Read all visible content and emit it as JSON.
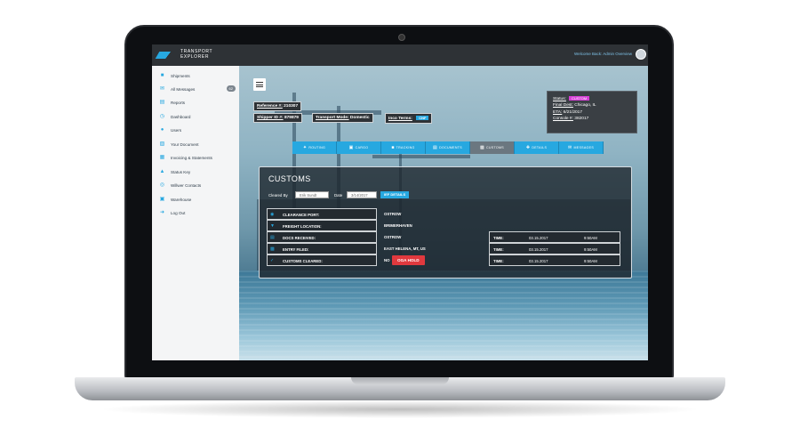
{
  "header": {
    "logo_line1": "TRANSPORT",
    "logo_line2": "EXPLORER",
    "welcome": "Welcome Back: Admin Overview"
  },
  "sidebar": {
    "items": [
      {
        "label": "Shipments",
        "icon": "truck-icon"
      },
      {
        "label": "All Messages",
        "icon": "messages-icon",
        "badge": "62"
      },
      {
        "label": "Reports",
        "icon": "reports-icon"
      },
      {
        "label": "Dashboard",
        "icon": "dashboard-icon"
      },
      {
        "label": "Users",
        "icon": "user-icon"
      },
      {
        "label": "Your Document",
        "icon": "document-icon"
      },
      {
        "label": "Invoicing & Statements",
        "icon": "invoice-icon"
      },
      {
        "label": "Status Key",
        "icon": "key-icon"
      },
      {
        "label": "Willwer Contacts",
        "icon": "contacts-icon"
      },
      {
        "label": "Warehouse",
        "icon": "warehouse-icon"
      },
      {
        "label": "Log Out",
        "icon": "logout-icon"
      }
    ]
  },
  "shipment": {
    "reference_label": "Reference #:",
    "reference_value": "210307",
    "shipper_label": "Shipper ID #:",
    "shipper_value": "879879",
    "mode_label": "Transport Mode:",
    "mode_value": "Domestic",
    "inco_label": "Inco Terms:",
    "inco_value": "CNF"
  },
  "status_box": {
    "status_label": "Status:",
    "status_value": "CUSTOM",
    "dest_label": "Final Dest:",
    "dest_value": "Chicago, IL",
    "eta_label": "ETA:",
    "eta_value": "6/21/2017",
    "console_label": "Console #:",
    "console_value": "382017"
  },
  "tabs": [
    {
      "label": "ROUTING",
      "icon": "route-icon"
    },
    {
      "label": "CARGO",
      "icon": "cargo-icon"
    },
    {
      "label": "TRACKING",
      "icon": "tracking-icon"
    },
    {
      "label": "DOCUMENTS",
      "icon": "folder-icon"
    },
    {
      "label": "CUSTOMS",
      "icon": "lock-icon",
      "active": true
    },
    {
      "label": "DETAILS",
      "icon": "details-icon"
    },
    {
      "label": "MESSAGES",
      "icon": "mail-icon"
    }
  ],
  "customs": {
    "title": "CUSTOMS",
    "cleared_by_label": "Cleared By",
    "cleared_by_value": "Erik Sundt",
    "date_label": "Date",
    "date_value": "3/14/2017",
    "ief_button": "IEF DETAILS",
    "rows": [
      {
        "label": "CLEARANCE PORT:",
        "value": "OSTROW",
        "icon": "port-icon"
      },
      {
        "label": "FREIGHT LOCATION:",
        "value": "BRIMERHAVEN",
        "icon": "location-icon"
      },
      {
        "label": "DOCS RECEIVED:",
        "value": "OSTROW",
        "icon": "docs-icon",
        "time_label": "TIME:",
        "date": "03.15.2017",
        "time": "9:50AM"
      },
      {
        "label": "ENTRY FILED:",
        "value": "EAST HELENA, MT, US",
        "icon": "entry-icon",
        "time_label": "TIME:",
        "date": "03.15.2017",
        "time": "9:50AM"
      },
      {
        "label": "CUSTOMS CLEARED:",
        "value": "NO",
        "icon": "check-icon",
        "hold": "OGA HOLD",
        "time_label": "TIME:",
        "date": "03.15.2017",
        "time": "9:50AM"
      }
    ]
  },
  "colors": {
    "accent": "#27a8e0",
    "status_tag": "#d63fd6",
    "hold": "#e0393e",
    "dark": "#2e3236"
  }
}
